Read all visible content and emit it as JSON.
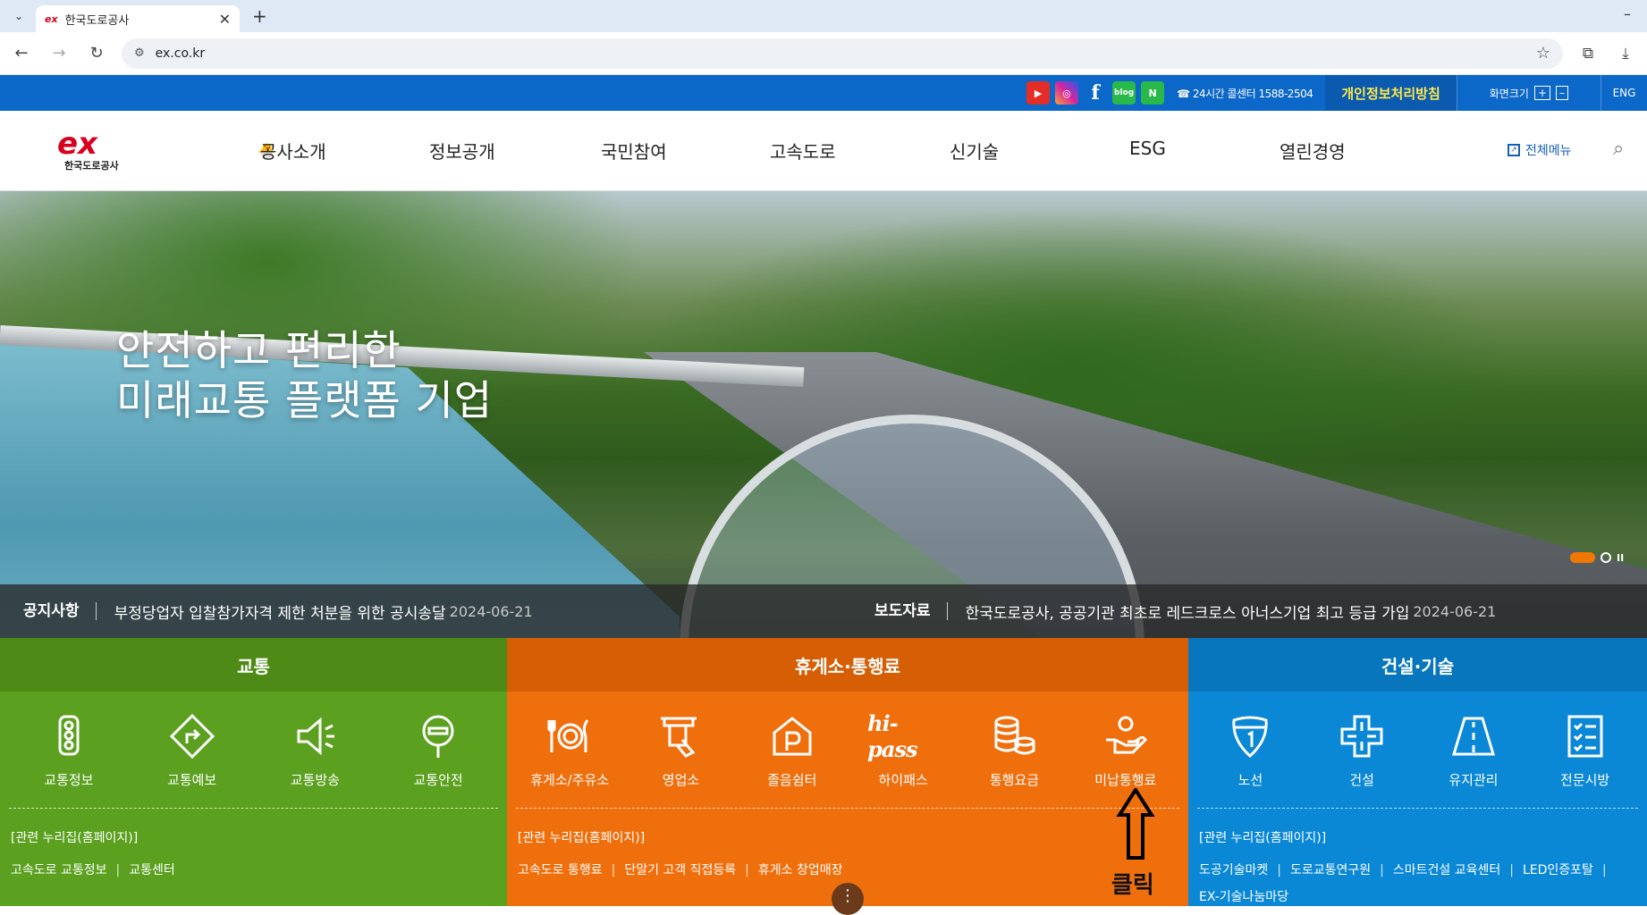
{
  "browser": {
    "tab_title": "한국도로공사",
    "tab_favicon": "ex",
    "url": "ex.co.kr",
    "new_tab": "+",
    "minimize": "–"
  },
  "utility": {
    "sns": [
      "youtube-icon",
      "instagram-icon",
      "facebook-icon",
      "blog-icon",
      "naver-post-icon"
    ],
    "blog_label": "blog",
    "naver_label": "N",
    "facebook_label": "f",
    "callcenter": "24시간 콜센터 1588-2504",
    "privacy": "개인정보처리방침",
    "fontsize": "화면크기",
    "fontsize_plus": "+",
    "fontsize_minus": "–",
    "eng": "ENG"
  },
  "header": {
    "logo_mark": "ex",
    "logo_text": "한국도로공사",
    "gnb": [
      "공사소개",
      "정보공개",
      "국민참여",
      "고속도로",
      "신기술",
      "ESG",
      "열린경영"
    ],
    "allmenu": "전체메뉴"
  },
  "hero": {
    "title_line1": "안전하고 편리한",
    "title_line2": "미래교통 플랫폼 기업",
    "notice": {
      "head": "공지사항",
      "text": "부정당업자 입찰참가자격 제한 처분을 위한 공시송달",
      "date": "2024-06-21"
    },
    "press": {
      "head": "보도자료",
      "text": "한국도로공사, 공공기관 최초로 레드크로스 아너스기업 최고 등급 가입",
      "date": "2024-06-21"
    }
  },
  "panels": {
    "traffic": {
      "title": "교통",
      "items": [
        "교통정보",
        "교통예보",
        "교통방송",
        "교통안전"
      ],
      "rel_title": "[관련 누리집(홈페이지)]",
      "links": [
        "고속도로 교통정보",
        "교통센터"
      ]
    },
    "rest": {
      "title": "휴게소·통행료",
      "items": [
        "휴게소/주유소",
        "영업소",
        "졸음쉼터",
        "하이패스",
        "통행요금",
        "미납통행료"
      ],
      "hipass_logo": "hi-pass",
      "rel_title": "[관련 누리집(홈페이지)]",
      "links": [
        "고속도로 통행료",
        "단말기 고객 직접등록",
        "휴게소 창업매장"
      ]
    },
    "construction": {
      "title": "건설·기술",
      "items": [
        "노선",
        "건설",
        "유지관리",
        "전문시방"
      ],
      "rel_title": "[관련 누리집(홈페이지)]",
      "links": [
        "도공기술마켓",
        "도로교통연구원",
        "스마트건설 교육센터",
        "LED인증포탈"
      ],
      "links2": [
        "EX-기술나눔마당"
      ]
    }
  },
  "annotation": {
    "click": "클릭"
  },
  "colors": {
    "util_blue": "#0b67c8",
    "traffic_green": "#5ba01f",
    "rest_orange": "#f06f0d",
    "construction_blue": "#0a88d6",
    "privacy_yellow": "#ffe94a"
  }
}
